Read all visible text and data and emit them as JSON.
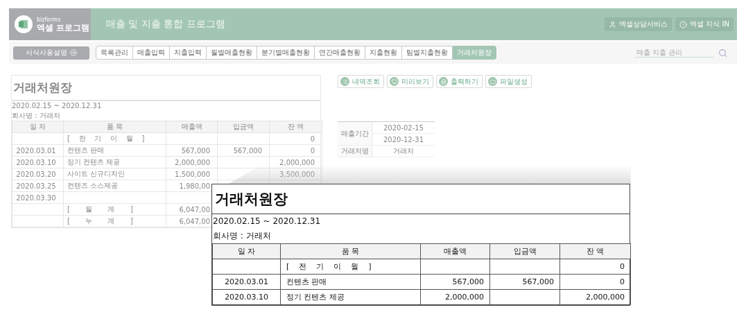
{
  "header": {
    "brand_small": "bizforms",
    "brand": "엑셀 프로그램",
    "title": "매출 및 지출 통합 프로그램",
    "buttons": [
      "엑셀상담서비스",
      "엑셀 지식 IN"
    ]
  },
  "nav": {
    "guide_button": "서식사용설명",
    "tabs": [
      {
        "label": "목록관리",
        "selected": false
      },
      {
        "label": "매출입력",
        "selected": false
      },
      {
        "label": "지출입력",
        "selected": false
      },
      {
        "label": "월별매출현황",
        "selected": false
      },
      {
        "label": "분기별매출현황",
        "selected": false
      },
      {
        "label": "연간매출현황",
        "selected": false
      },
      {
        "label": "지출현황",
        "selected": false
      },
      {
        "label": "팀별지출현황",
        "selected": false
      },
      {
        "label": "거래처원장",
        "selected": true
      }
    ],
    "search": {
      "placeholder": "매출 지출 관리"
    }
  },
  "sheet": {
    "title": "거래처원장",
    "period": "2020.02.15 ~ 2020.12.31",
    "company": "회사명 : 거래처",
    "columns": [
      "일 자",
      "품 목",
      "매출액",
      "입금액",
      "잔 액"
    ],
    "rows": [
      {
        "date": "",
        "item": "[    전    기    이    월    ]",
        "sales": "",
        "deposit": "",
        "balance": "0"
      },
      {
        "date": "2020.03.01",
        "item": "컨텐즈 판매",
        "sales": "567,000",
        "deposit": "567,000",
        "balance": "0"
      },
      {
        "date": "2020.03.10",
        "item": "정기 컨텐츠 제공",
        "sales": "2,000,000",
        "deposit": "",
        "balance": "2,000,000"
      },
      {
        "date": "2020.03.20",
        "item": "사이트 신규디자인",
        "sales": "1,500,000",
        "deposit": "",
        "balance": "3,500,000"
      },
      {
        "date": "2020.03.25",
        "item": "컨텐즈 소스제공",
        "sales": "1,980,00",
        "deposit": "",
        "balance": ""
      },
      {
        "date": "2020.03.30",
        "item": "",
        "sales": "",
        "deposit": "",
        "balance": ""
      },
      {
        "date": "",
        "item": "[       월       계       ]",
        "sales": "6,047,00",
        "deposit": "",
        "balance": ""
      },
      {
        "date": "",
        "item": "[       누       계       ]",
        "sales": "6,047,00",
        "deposit": "",
        "balance": ""
      }
    ]
  },
  "actions": [
    "내역조회",
    "미리보기",
    "출력하기",
    "파일생성"
  ],
  "info": {
    "period_label": "매출기간",
    "period_start": "2020-02-15",
    "period_end": "2020-12-31",
    "client_label": "거래처명",
    "client": "거래처"
  },
  "zoom": {
    "title": "거래처원장",
    "period": "2020.02.15 ~ 2020.12.31",
    "company": "회사명 : 거래처",
    "columns": [
      "일 자",
      "품 목",
      "매출액",
      "입금액",
      "잔 액"
    ],
    "rows": [
      {
        "date": "",
        "item": "[    전    기    이    월    ]",
        "sales": "",
        "deposit": "",
        "balance": "0"
      },
      {
        "date": "2020.03.01",
        "item": "컨텐츠 판매",
        "sales": "567,000",
        "deposit": "567,000",
        "balance": "0"
      },
      {
        "date": "2020.03.10",
        "item": "정기 컨텐츠 제공",
        "sales": "2,000,000",
        "deposit": "",
        "balance": "2,000,000"
      }
    ]
  }
}
